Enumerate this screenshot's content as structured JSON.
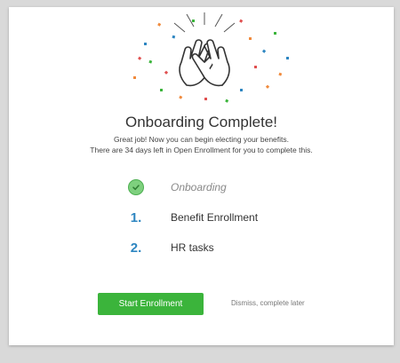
{
  "modal": {
    "title": "Onboarding Complete!",
    "subtitle_line1": "Great job! Now you can begin electing your benefits.",
    "subtitle_line2": "There are 34 days left in Open Enrollment for you to complete this."
  },
  "steps": [
    {
      "marker": "check-icon",
      "label": "Onboarding",
      "status": "done"
    },
    {
      "marker": "1.",
      "label": "Benefit Enrollment",
      "status": "pending"
    },
    {
      "marker": "2.",
      "label": "HR tasks",
      "status": "pending"
    }
  ],
  "actions": {
    "primary_label": "Start Enrollment",
    "secondary_label": "Dismiss, complete later"
  },
  "colors": {
    "primary": "#3bb43b",
    "step_number": "#2e86c1",
    "check": "#7ed07e"
  }
}
